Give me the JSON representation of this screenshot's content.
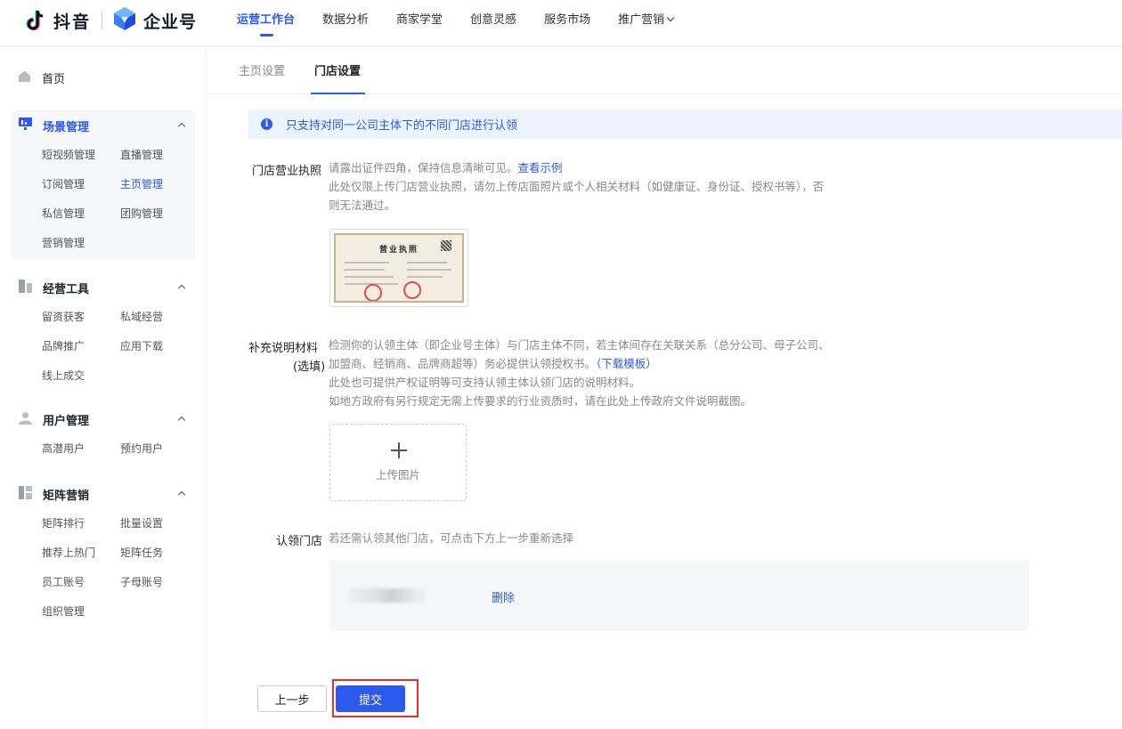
{
  "header": {
    "brand_primary": "抖音",
    "brand_secondary": "企业号",
    "nav": [
      {
        "label": "运营工作台",
        "active": true
      },
      {
        "label": "数据分析"
      },
      {
        "label": "商家学堂"
      },
      {
        "label": "创意灵感"
      },
      {
        "label": "服务市场"
      },
      {
        "label": "推广营销",
        "dropdown": true
      }
    ]
  },
  "sidebar": {
    "home": "首页",
    "groups": [
      {
        "title": "场景管理",
        "icon": "scene-icon",
        "items": [
          "短视频管理",
          "直播管理",
          "订阅管理",
          "主页管理",
          "私信管理",
          "团购管理",
          "营销管理"
        ],
        "active_item": "主页管理"
      },
      {
        "title": "经营工具",
        "icon": "tools-icon",
        "items": [
          "留资获客",
          "私域经营",
          "品牌推广",
          "应用下载",
          "线上成交"
        ]
      },
      {
        "title": "用户管理",
        "icon": "user-icon",
        "items": [
          "高潜用户",
          "预约用户"
        ]
      },
      {
        "title": "矩阵营销",
        "icon": "matrix-icon",
        "items": [
          "矩阵排行",
          "批量设置",
          "推荐上热门",
          "矩阵任务",
          "员工账号",
          "子母账号",
          "组织管理"
        ]
      }
    ]
  },
  "tabs": [
    {
      "label": "主页设置"
    },
    {
      "label": "门店设置",
      "active": true
    }
  ],
  "notice": "只支持对同一公司主体下的不同门店进行认领",
  "license": {
    "label": "门店营业执照",
    "desc_line1": "请露出证件四角，保持信息清晰可见。",
    "example_link": "查看示例",
    "desc_line2": "此处仅限上传门店营业执照，请勿上传店面照片或个人相关材料（如健康证、身份证、授权书等），否",
    "desc_line3": "则无法通过。",
    "image_title": "营业执照"
  },
  "supplement": {
    "label_line1": "补充说明材料",
    "label_line2": "(选填)",
    "desc_line1": "检测你的认领主体（即企业号主体）与门店主体不同，若主体间存在关联关系（总分公司、母子公司、",
    "desc_line2": "加盟商、经销商、品牌商超等）务必提供认领授权书。",
    "template_link": "（下载模板）",
    "desc_line3": "此处也可提供产权证明等可支持认领主体认领门店的说明材料。",
    "desc_line4": "如地方政府有另行规定无需上传要求的行业资质时，请在此处上传政府文件说明截图。",
    "upload_label": "上传图片"
  },
  "claim": {
    "label": "认领门店",
    "desc": "若还需认领其他门店，可点击下方上一步重新选择",
    "delete": "删除"
  },
  "actions": {
    "prev": "上一步",
    "submit": "提交"
  },
  "colors": {
    "accent": "#2b5aed",
    "highlight_border": "#e5312f",
    "notice_bg": "#eaf3fe"
  }
}
